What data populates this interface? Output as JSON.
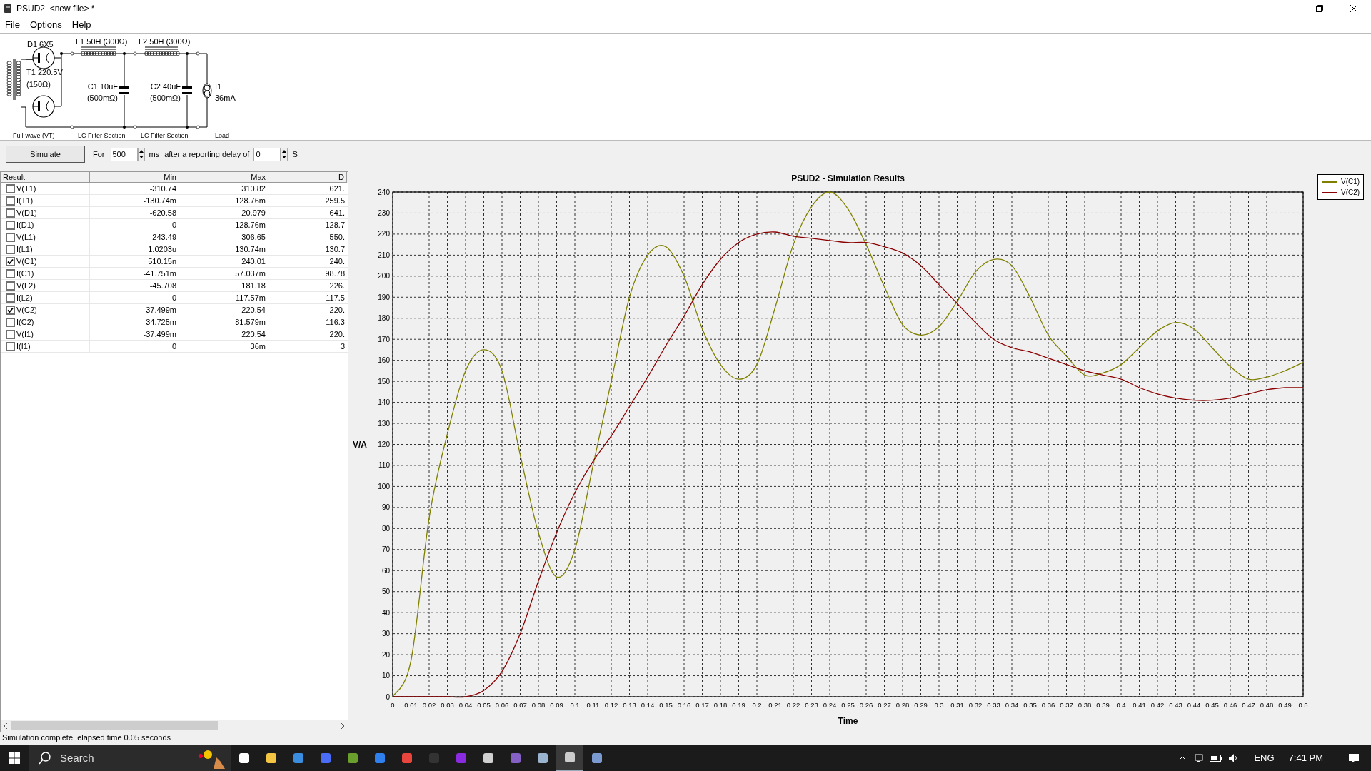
{
  "window": {
    "title": "PSUD2  <new file> *"
  },
  "menu": [
    "File",
    "Options",
    "Help"
  ],
  "schematic": {
    "labels": [
      "D1 6X5",
      "L1 50H (300Ω)",
      "L2 50H (300Ω)",
      "T1 220.5V",
      "(150Ω)",
      "C1 10uF",
      "(500mΩ)",
      "C2 40uF",
      "(500mΩ)",
      "I1",
      "36mA"
    ],
    "sections": [
      "Full-wave (VT)",
      "LC Filter Section",
      "LC Filter Section",
      "Load"
    ]
  },
  "toolbar": {
    "button": "Simulate",
    "for_label": "For",
    "duration": "500",
    "duration_unit": "ms",
    "delay_label": "after a reporting delay of",
    "delay": "0",
    "delay_unit": "S"
  },
  "table": {
    "columns": [
      "Result",
      "Min",
      "Max",
      "D"
    ],
    "rows": [
      {
        "checked": false,
        "name": "V(T1)",
        "min": "-310.74",
        "max": "310.82",
        "column_4": "621."
      },
      {
        "checked": false,
        "name": "I(T1)",
        "min": "-130.74m",
        "max": "128.76m",
        "column_4": "259.5"
      },
      {
        "checked": false,
        "name": "V(D1)",
        "min": "-620.58",
        "max": "20.979",
        "column_4": "641."
      },
      {
        "checked": false,
        "name": "I(D1)",
        "min": "0",
        "max": "128.76m",
        "column_4": "128.7"
      },
      {
        "checked": false,
        "name": "V(L1)",
        "min": "-243.49",
        "max": "306.65",
        "column_4": "550."
      },
      {
        "checked": false,
        "name": "I(L1)",
        "min": "1.0203u",
        "max": "130.74m",
        "column_4": "130.7"
      },
      {
        "checked": true,
        "name": "V(C1)",
        "min": "510.15n",
        "max": "240.01",
        "column_4": "240."
      },
      {
        "checked": false,
        "name": "I(C1)",
        "min": "-41.751m",
        "max": "57.037m",
        "column_4": "98.78"
      },
      {
        "checked": false,
        "name": "V(L2)",
        "min": "-45.708",
        "max": "181.18",
        "column_4": "226."
      },
      {
        "checked": false,
        "name": "I(L2)",
        "min": "0",
        "max": "117.57m",
        "column_4": "117.5"
      },
      {
        "checked": true,
        "name": "V(C2)",
        "min": "-37.499m",
        "max": "220.54",
        "column_4": "220."
      },
      {
        "checked": false,
        "name": "I(C2)",
        "min": "-34.725m",
        "max": "81.579m",
        "column_4": "116.3"
      },
      {
        "checked": false,
        "name": "V(I1)",
        "min": "-37.499m",
        "max": "220.54",
        "column_4": "220."
      },
      {
        "checked": false,
        "name": "I(I1)",
        "min": "0",
        "max": "36m",
        "column_4": "3"
      }
    ]
  },
  "chart": {
    "chart_data": {
      "type": "line",
      "title": "PSUD2 - Simulation Results",
      "xlabel": "Time",
      "ylabel": "V/A",
      "x": [
        0,
        0.01,
        0.02,
        0.03,
        0.04,
        0.05,
        0.06,
        0.07,
        0.08,
        0.09,
        0.1,
        0.11,
        0.12,
        0.13,
        0.14,
        0.15,
        0.16,
        0.17,
        0.18,
        0.19,
        0.2,
        0.21,
        0.22,
        0.23,
        0.24,
        0.25,
        0.26,
        0.27,
        0.28,
        0.29,
        0.3,
        0.31,
        0.32,
        0.33,
        0.34,
        0.35,
        0.36,
        0.37,
        0.38,
        0.39,
        0.4,
        0.41,
        0.42,
        0.43,
        0.44,
        0.45,
        0.46,
        0.47,
        0.48,
        0.49,
        0.5
      ],
      "series": [
        {
          "name": "V(C1)",
          "color": "#808000",
          "values": [
            0,
            17,
            85,
            125,
            155,
            165,
            155,
            115,
            78,
            57,
            70,
            110,
            150,
            190,
            210,
            214,
            200,
            175,
            158,
            151,
            158,
            185,
            215,
            233,
            240,
            232,
            215,
            195,
            177,
            172,
            176,
            188,
            202,
            208,
            205,
            190,
            172,
            162,
            153,
            154,
            158,
            166,
            174,
            178,
            175,
            166,
            157,
            151,
            152,
            155,
            159
          ]
        },
        {
          "name": "V(C2)",
          "color": "#8b0000",
          "values": [
            0,
            0,
            0,
            0,
            0,
            3,
            12,
            30,
            55,
            78,
            97,
            112,
            124,
            138,
            152,
            167,
            181,
            196,
            208,
            216,
            220,
            221,
            219,
            218,
            217,
            216,
            216,
            214,
            211,
            205,
            196,
            187,
            178,
            170,
            166,
            164,
            161,
            158,
            155,
            153,
            151,
            147,
            144,
            142,
            141,
            141,
            142,
            144,
            146,
            147,
            147
          ]
        }
      ],
      "xlim": [
        0,
        0.5
      ],
      "ylim": [
        0,
        240
      ],
      "xticks": [
        0,
        0.01,
        0.02,
        0.03,
        0.04,
        0.05,
        0.06,
        0.07,
        0.08,
        0.09,
        0.1,
        0.11,
        0.12,
        0.13,
        0.14,
        0.15,
        0.16,
        0.17,
        0.18,
        0.19,
        0.2,
        0.21,
        0.22,
        0.23,
        0.24,
        0.25,
        0.26,
        0.27,
        0.28,
        0.29,
        0.3,
        0.31,
        0.32,
        0.33,
        0.34,
        0.35,
        0.36,
        0.37,
        0.38,
        0.39,
        0.4,
        0.41,
        0.42,
        0.43,
        0.44,
        0.45,
        0.46,
        0.47,
        0.48,
        0.49,
        0.5
      ],
      "yticks": [
        0,
        10,
        20,
        30,
        40,
        50,
        60,
        70,
        80,
        90,
        100,
        110,
        120,
        130,
        140,
        150,
        160,
        170,
        180,
        190,
        200,
        210,
        220,
        230,
        240
      ],
      "grid": true
    }
  },
  "status_bar": "Simulation complete, elapsed time 0.05 seconds",
  "taskbar": {
    "search": "Search",
    "language": "ENG",
    "time": "7:41 PM"
  }
}
